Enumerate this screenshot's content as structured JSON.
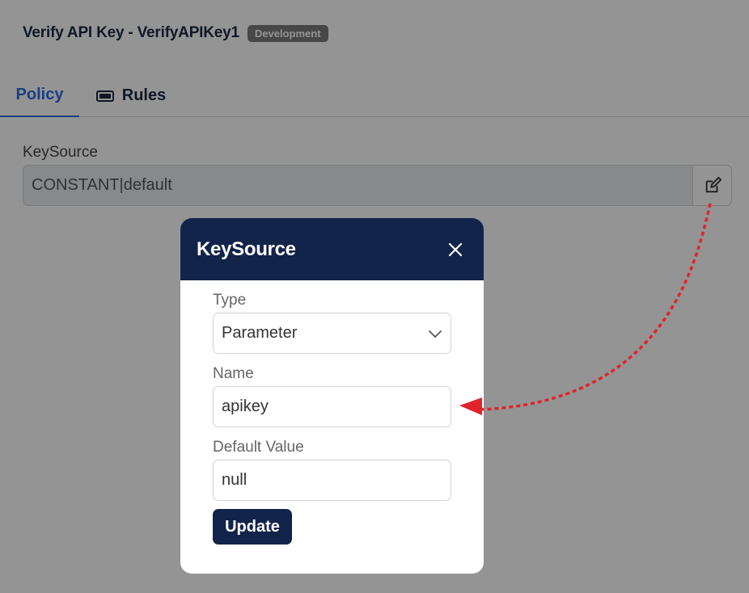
{
  "header": {
    "title": "Verify API Key - VerifyAPIKey1",
    "badge": "Development"
  },
  "tabs": [
    {
      "label": "Policy",
      "active": true
    },
    {
      "label": "Rules",
      "icon": "rules-icon"
    }
  ],
  "keysource": {
    "label": "KeySource",
    "value": "CONSTANT|default",
    "edit_icon": "edit-icon"
  },
  "modal": {
    "title": "KeySource",
    "close_icon": "close-icon",
    "type_label": "Type",
    "type_value": "Parameter",
    "name_label": "Name",
    "name_value": "apikey",
    "default_label": "Default Value",
    "default_value": "null",
    "update_label": "Update"
  },
  "colors": {
    "accent": "#2d6be0",
    "modal_header": "#13244a",
    "annotation_arrow": "#e0242a"
  }
}
